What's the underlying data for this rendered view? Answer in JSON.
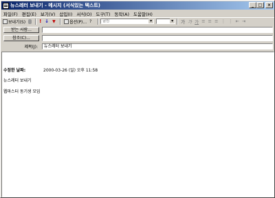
{
  "window": {
    "title": "뉴스레터 보내기 - 메시지 (서식있는 텍스트)",
    "controls": [
      "_",
      "□",
      "×"
    ]
  },
  "menu": [
    "파일(F)",
    "편집(E)",
    "보기(V)",
    "삽입(I)",
    "서식(O)",
    "도구(T)",
    "동작(A)",
    "도움말(H)"
  ],
  "toolbar": {
    "send_label": "보내기(S)",
    "options_label": "옵션(P)...",
    "font_combo": "굴림",
    "size_combo": "",
    "format_buttons": [
      "가",
      "가",
      "가",
      "≡",
      "≡",
      "≡",
      "⋮",
      "⋮",
      "⇤",
      "⇥"
    ]
  },
  "header": {
    "to_button": "받는 사람...",
    "cc_button": "참조(C)...",
    "subject_label": "제목(J):",
    "to_value": "",
    "cc_value": "",
    "subject_value": "뉴스레터 보내기"
  },
  "body": {
    "modified_label": "수정한 날짜:",
    "modified_value": "2000-03-26 (일) 오후 11:58",
    "line1": "뉴스레터 보내기",
    "line2": "웹마스터 동기생 모임"
  }
}
